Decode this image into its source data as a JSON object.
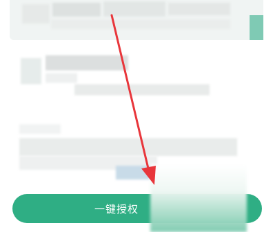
{
  "authorize_button": {
    "label": "一键授权"
  },
  "colors": {
    "primary": "#2fae84",
    "annotation_arrow": "#e8363b",
    "mosaic_light": "#eef2f1",
    "mosaic_mid": "#dde3e1"
  },
  "icons": {
    "annotation": "red-arrow-icon"
  }
}
